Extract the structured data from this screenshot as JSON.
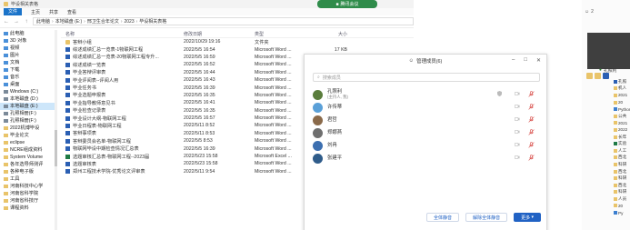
{
  "explorer": {
    "title": "毕设相关表格",
    "ribbon_tabs": [
      "文件",
      "主页",
      "共享",
      "查看"
    ],
    "address_path": [
      "此电脑",
      "本地磁盘 (E:)",
      "邢卫生合年论文",
      "2023",
      "毕设相关表格"
    ],
    "columns": {
      "name": "名称",
      "date": "修改日期",
      "type": "类型",
      "size": "大小"
    },
    "sidebar": [
      {
        "label": "此电脑",
        "icon": "computer-icon",
        "selected": false
      },
      {
        "label": "3D 对象",
        "icon": "cube-icon",
        "selected": false
      },
      {
        "label": "视频",
        "icon": "video-icon",
        "selected": false
      },
      {
        "label": "图片",
        "icon": "picture-icon",
        "selected": false
      },
      {
        "label": "文档",
        "icon": "document-icon",
        "selected": false
      },
      {
        "label": "下载",
        "icon": "download-icon",
        "selected": false
      },
      {
        "label": "音乐",
        "icon": "music-icon",
        "selected": false
      },
      {
        "label": "桌面",
        "icon": "desktop-icon",
        "selected": false
      },
      {
        "label": "Windows (C:)",
        "icon": "drive-icon",
        "selected": false
      },
      {
        "label": "本地磁盘 (D:)",
        "icon": "drive-icon",
        "selected": false
      },
      {
        "label": "本地磁盘 (E:)",
        "icon": "drive-icon",
        "selected": true
      },
      {
        "label": "孔照相册(F:)",
        "icon": "drive-icon",
        "selected": false
      },
      {
        "label": "孔照相册(F:)",
        "icon": "drive-icon",
        "selected": false
      },
      {
        "label": "2022机博毕设",
        "icon": "folder-icon",
        "selected": false
      },
      {
        "label": "毕业论文",
        "icon": "folder-icon",
        "selected": false
      },
      {
        "label": "eclipse",
        "icon": "folder-icon",
        "selected": false
      },
      {
        "label": "NCRE组成资料",
        "icon": "folder-icon",
        "selected": false
      },
      {
        "label": "System Volume",
        "icon": "folder-icon",
        "selected": false
      },
      {
        "label": "各年选导师测评",
        "icon": "folder-icon",
        "selected": false
      },
      {
        "label": "各种电子版",
        "icon": "folder-icon",
        "selected": false
      },
      {
        "label": "工具",
        "icon": "folder-icon",
        "selected": false
      },
      {
        "label": "河南科技中心学",
        "icon": "folder-icon",
        "selected": false
      },
      {
        "label": "河南省科学院",
        "icon": "folder-icon",
        "selected": false
      },
      {
        "label": "河南省科技厅",
        "icon": "folder-icon",
        "selected": false
      },
      {
        "label": "课程资料",
        "icon": "folder-icon",
        "selected": false
      }
    ],
    "files": [
      {
        "name": "答辩小组",
        "date": "2022/10/29 19:16",
        "type": "文件夹",
        "size": "",
        "kind": "folder"
      },
      {
        "name": "综述成绩汇总一览表-1物联网工程",
        "date": "2022/5/5 16:54",
        "type": "Microsoft Word ...",
        "size": "17 KB",
        "kind": "word"
      },
      {
        "name": "综述成绩汇总一览表-20物联网工程专升...",
        "date": "2022/5/5 16:59",
        "type": "Microsoft Word ...",
        "size": "",
        "kind": "word"
      },
      {
        "name": "综述成绩一览表",
        "date": "2022/5/5 16:52",
        "type": "Microsoft Word ...",
        "size": "",
        "kind": "word"
      },
      {
        "name": "毕业答辩评审表",
        "date": "2022/5/5 16:44",
        "type": "Microsoft Word ...",
        "size": "",
        "kind": "word"
      },
      {
        "name": "毕业评阅表--评阅人用",
        "date": "2022/5/5 16:43",
        "type": "Microsoft Word ...",
        "size": "",
        "kind": "word"
      },
      {
        "name": "毕业任务书",
        "date": "2022/5/5 16:39",
        "type": "Microsoft Word ...",
        "size": "",
        "kind": "word"
      },
      {
        "name": "毕业选题申报表",
        "date": "2022/5/5 16:35",
        "type": "Microsoft Word ...",
        "size": "",
        "kind": "word"
      },
      {
        "name": "毕业指导教师意见书",
        "date": "2022/5/5 16:41",
        "type": "Microsoft Word ...",
        "size": "",
        "kind": "word"
      },
      {
        "name": "毕业检查记录表",
        "date": "2022/5/5 16:35",
        "type": "Microsoft Word ...",
        "size": "",
        "kind": "word"
      },
      {
        "name": "毕业设计大纲-物联网工程",
        "date": "2022/5/5 16:57",
        "type": "Microsoft Word ...",
        "size": "",
        "kind": "word"
      },
      {
        "name": "毕业日程表-物联网工程",
        "date": "2022/5/11 8:52",
        "type": "Microsoft Word ...",
        "size": "",
        "kind": "word"
      },
      {
        "name": "答辩事项表",
        "date": "2022/5/11 8:53",
        "type": "Microsoft Word ...",
        "size": "",
        "kind": "word"
      },
      {
        "name": "答辩委员会名单-物联网工程",
        "date": "2022/5/5 8:53",
        "type": "Microsoft Word ...",
        "size": "",
        "kind": "word"
      },
      {
        "name": "物联网毕设中期检查情况汇总表",
        "date": "2022/5/5 16:39",
        "type": "Microsoft Word ...",
        "size": "",
        "kind": "word"
      },
      {
        "name": "选题审核汇总表-物联网工程--2023届",
        "date": "2022/5/23 15:58",
        "type": "Microsoft Excel ...",
        "size": "",
        "kind": "excel"
      },
      {
        "name": "选题审核表",
        "date": "2022/5/23 15:58",
        "type": "Microsoft Word ...",
        "size": "",
        "kind": "word"
      },
      {
        "name": "郑州工程技术学院-优秀论文评审表",
        "date": "2022/5/11 9:54",
        "type": "Microsoft Word ...",
        "size": "",
        "kind": "word"
      }
    ]
  },
  "share_tip": "腾讯会议",
  "member_dialog": {
    "title": "管理成员(6)",
    "search_placeholder": "搜索成员",
    "members": [
      {
        "name": "孔照利",
        "sub": "(主持人, 我)",
        "color": "#5a7d3c"
      },
      {
        "name": "许传蒂",
        "sub": "",
        "color": "#5aa0d8"
      },
      {
        "name": "君哲",
        "sub": "",
        "color": "#8a6a4a"
      },
      {
        "name": "郑娜燕",
        "sub": "",
        "color": "#6f6f6f"
      },
      {
        "name": "刘冉",
        "sub": "",
        "color": "#3c6fb0"
      },
      {
        "name": "张建平",
        "sub": "",
        "color": "#2f5c8a"
      }
    ],
    "buttons": {
      "mute_all": "全体静音",
      "unmute_all": "解除全体静音",
      "more": "更多"
    }
  },
  "right_panel": {
    "top_label": "2",
    "host_name": "孔照利",
    "list": [
      "孔照",
      "机人",
      "2021",
      "20",
      "Python",
      "公共",
      "2021",
      "2022",
      "长年",
      "实验",
      "人工",
      "西北",
      "科研",
      "西北",
      "科研",
      "西北",
      "科研",
      "人员",
      "20",
      "Py"
    ]
  },
  "colors": {
    "accent": "#2162c4",
    "selection": "#cde6fa",
    "word": "#2b5fb3",
    "excel": "#1f7a45",
    "folder": "#e9c46a"
  }
}
